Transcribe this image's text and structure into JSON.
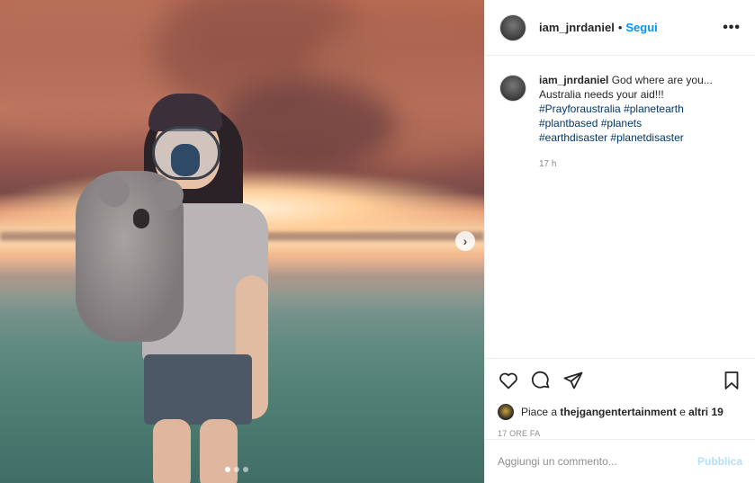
{
  "post": {
    "username": "iam_jnrdaniel",
    "separator": "•",
    "follow_label": "Segui",
    "more_icon": "more-horizontal-icon",
    "caption_username": "iam_jnrdaniel",
    "caption_text": "God where are you... Australia needs your aid!!!",
    "hashtags": [
      "#Prayforaustralia",
      "#planetearth",
      "#plantbased",
      "#planets",
      "#earthdisaster",
      "#planetdisaster"
    ],
    "caption_time": "17 h"
  },
  "carousel": {
    "next_icon": "chevron-right-icon",
    "next_glyph": "›",
    "dots": 3,
    "active_dot": 0
  },
  "actions": {
    "like_icon": "heart-icon",
    "comment_icon": "comment-icon",
    "share_icon": "paper-plane-icon",
    "save_icon": "bookmark-icon",
    "likes_prefix": "Piace a ",
    "likes_user": "thejgangentertainment",
    "likes_middle": " e ",
    "likes_others": "altri 19",
    "time_ago": "17 ORE FA"
  },
  "comment_box": {
    "placeholder": "Aggiungi un commento...",
    "publish_label": "Pubblica"
  },
  "colors": {
    "accent": "#0095f6",
    "hashtag": "#00376b",
    "muted": "#8e8e8e",
    "publish_disabled": "#b2dffc"
  }
}
